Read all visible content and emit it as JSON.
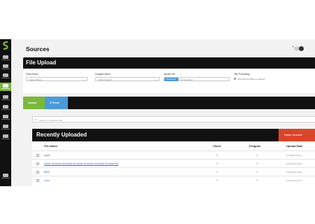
{
  "sidebar": {
    "items": [
      {
        "icon": "upload-cloud-icon",
        "active": false
      },
      {
        "icon": "list-icon",
        "active": false
      },
      {
        "icon": "inbox-icon",
        "active": false
      },
      {
        "icon": "folder-icon",
        "active": true
      },
      {
        "icon": "file-icon",
        "active": false
      },
      {
        "icon": "person-icon",
        "active": false
      },
      {
        "icon": "globe-icon",
        "active": false
      },
      {
        "icon": "chart-icon",
        "active": false
      },
      {
        "icon": "settings-icon",
        "active": false
      },
      {
        "icon": "exit-icon",
        "active": false
      }
    ],
    "accent": "#7ab83a"
  },
  "page": {
    "title": "Sources",
    "toggle_plus": "+"
  },
  "file_upload": {
    "title": "File Upload",
    "client_label": "Client Name",
    "client_value": "Select Adapter",
    "program_label": "Program Name",
    "program_value": "Select Program",
    "upload_file_label": "Upload File",
    "upload_info": "ⓘ",
    "choose_file": "Choose File",
    "no_file": "No file chosen",
    "processing_label": "Title Processing",
    "processing_option": "Run file Post Office on load job"
  },
  "actions": {
    "upload": "Upload",
    "reset": "⟳ Reset"
  },
  "search": {
    "placeholder": "Search on Uploaded files",
    "icon": "search-icon"
  },
  "recent": {
    "title": "Recently Uploaded",
    "delete_label": "Delete Selected",
    "columns": {
      "file": "File Name",
      "client": "Client",
      "program": "Program",
      "date": "Upload Date"
    },
    "rows": [
      {
        "name": "Apple",
        "long": false,
        "date": "12/1/2021 10:01"
      },
      {
        "name": "Adobe 56 Adobe 56 Adobe 56 Adobe 56 Adobe 56 Adobe 56 Adobe 56",
        "long": true,
        "date": "12/1/2021 10:02"
      },
      {
        "name": "Bitrix",
        "long": false,
        "date": "12/1/2021 10:03"
      },
      {
        "name": "Cisco",
        "long": false,
        "date": "12/1/2021 10:04"
      }
    ]
  },
  "colors": {
    "dark": "#111111",
    "green": "#7ab83a",
    "blue": "#4a9ad8",
    "red": "#d9452a"
  }
}
